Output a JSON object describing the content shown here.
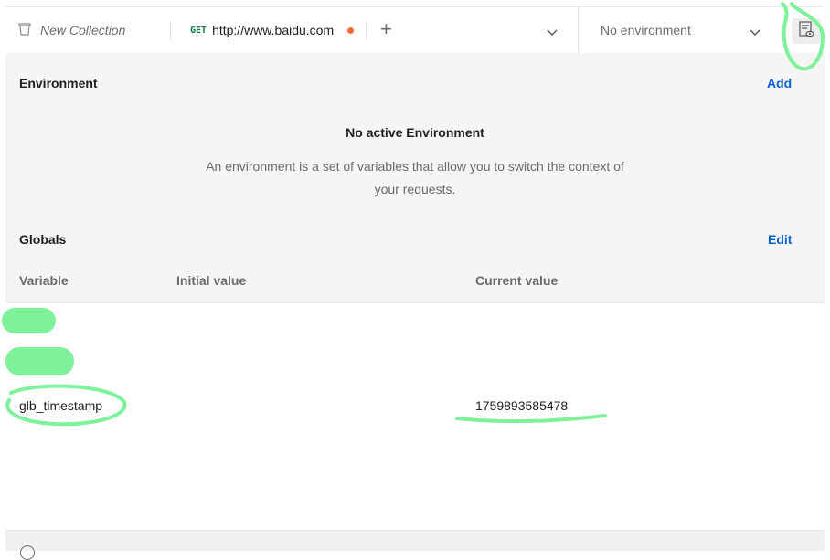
{
  "tabs": {
    "collection_label": "New Collection",
    "request_method": "GET",
    "request_url": "http://www.baidu.com",
    "new_tab_symbol": "+"
  },
  "environment_selector": {
    "selected": "No environment"
  },
  "environment": {
    "title": "Environment",
    "add_label": "Add",
    "empty_title": "No active Environment",
    "empty_description": "An environment is a set of variables that allow you to switch the context of your requests."
  },
  "globals": {
    "title": "Globals",
    "edit_label": "Edit",
    "columns": {
      "variable": "Variable",
      "initial": "Initial value",
      "current": "Current value"
    },
    "rows": [
      {
        "variable": "",
        "initial": "",
        "current": ""
      },
      {
        "variable": "",
        "initial": "",
        "current": ""
      },
      {
        "variable": "glb_timestamp",
        "initial": "",
        "current": "1759893585478"
      }
    ]
  },
  "colors": {
    "accent_link": "#0b5fd1",
    "method_get": "#0c7a43",
    "unsaved_dot": "#f26b3a",
    "annotation": "#7ef29a"
  }
}
